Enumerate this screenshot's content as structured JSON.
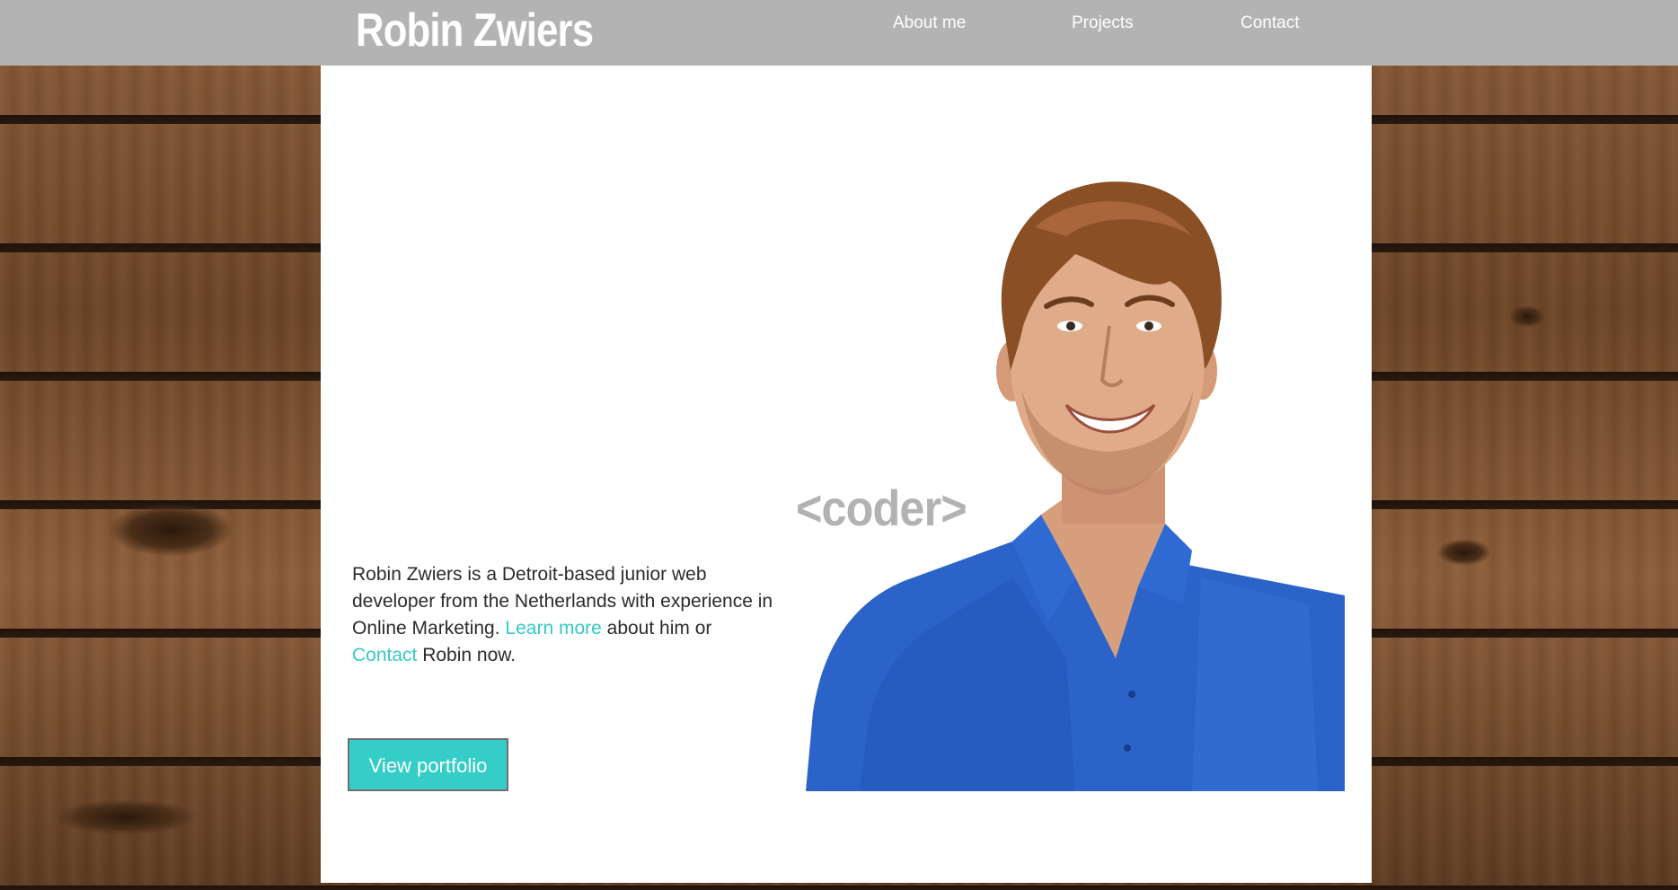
{
  "header": {
    "brand": "Robin Zwiers",
    "nav": [
      {
        "label": "About me"
      },
      {
        "label": "Projects"
      },
      {
        "label": "Contact"
      }
    ]
  },
  "hero": {
    "tagline": "<coder>",
    "intro": {
      "text_1": "Robin Zwiers is a Detroit-based junior web developer from the Netherlands with experience in Online Marketing. ",
      "link_learn_more": "Learn more",
      "text_2": " about him or ",
      "link_contact": "Contact",
      "text_3": " Robin now."
    },
    "cta_label": "View portfolio"
  },
  "colors": {
    "header_bg": "#b3b3b3",
    "accent": "#35cdc7",
    "link": "#35c9c6",
    "panel_bg": "#ffffff",
    "tagline": "#b2b2b2"
  },
  "icons": {
    "portrait": "person-portrait-photo"
  }
}
